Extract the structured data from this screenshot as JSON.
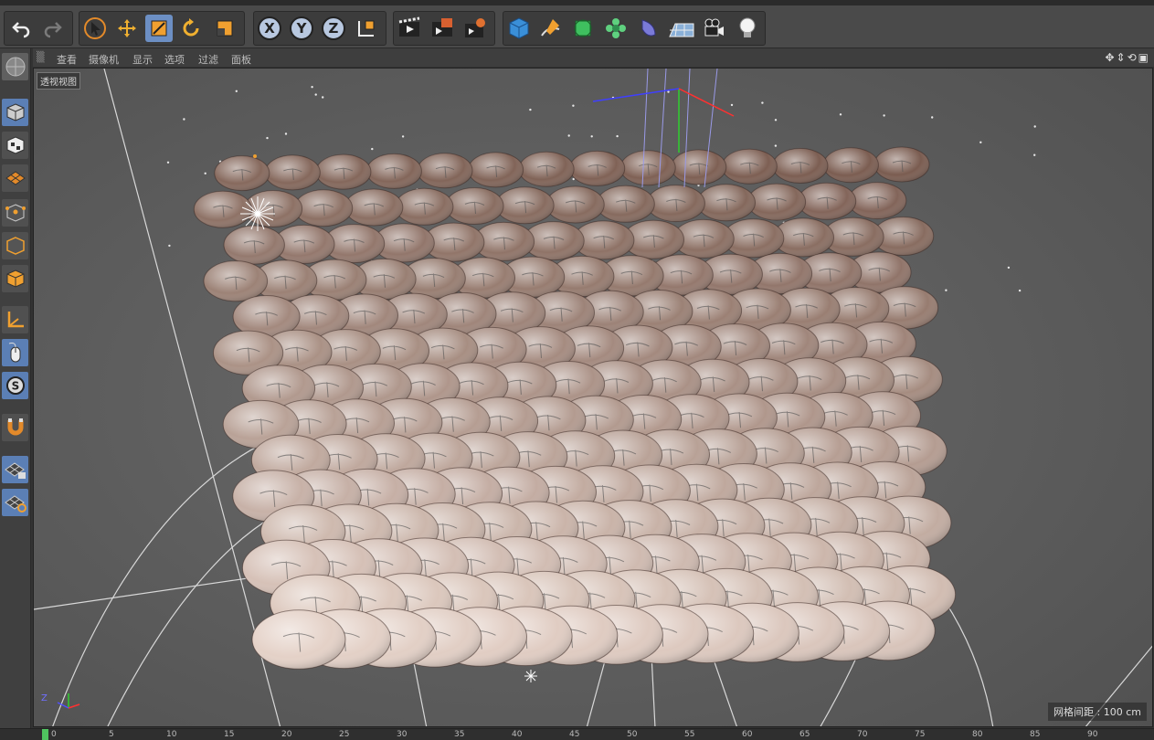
{
  "toolbar": {
    "undo_icon": "undo-icon",
    "redo_icon": "redo-icon",
    "axis_x": "X",
    "axis_y": "Y",
    "axis_z": "Z"
  },
  "viewport_menu": [
    "查看",
    "摄像机",
    "显示",
    "选项",
    "过滤",
    "面板"
  ],
  "viewport": {
    "label": "透视视图",
    "grid_spacing": "网格间距 : 100 cm",
    "axis_z": "Z"
  },
  "timeline": {
    "ticks": [
      "0",
      "5",
      "10",
      "15",
      "20",
      "25",
      "30",
      "35",
      "40",
      "45",
      "50",
      "55",
      "60",
      "65",
      "70",
      "75",
      "80",
      "85",
      "90"
    ]
  },
  "colors": {
    "accent_active": "#6c8fc4",
    "scale_tool_active": "#f0a030",
    "scales_light": "#f7e6dc",
    "scales_dark": "#7a5c50"
  }
}
